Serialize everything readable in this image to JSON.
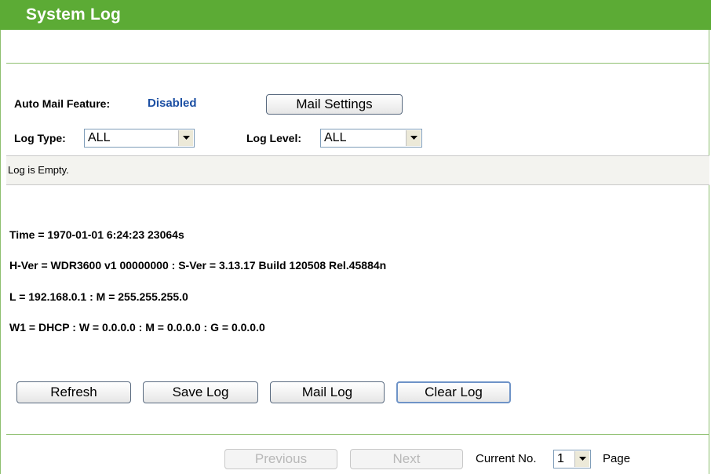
{
  "header": {
    "title": "System Log"
  },
  "mail": {
    "label": "Auto Mail Feature:",
    "status": "Disabled",
    "settings_button": "Mail Settings"
  },
  "filters": {
    "log_type_label": "Log Type:",
    "log_type_value": "ALL",
    "log_level_label": "Log Level:",
    "log_level_value": "ALL"
  },
  "log": {
    "message": "Log is Empty."
  },
  "info": {
    "time": "Time = 1970-01-01 6:24:23 23064s",
    "version": "H-Ver = WDR3600 v1 00000000 : S-Ver = 3.13.17 Build 120508 Rel.45884n",
    "lan": "L = 192.168.0.1 : M = 255.255.255.0",
    "wan": "W1 = DHCP : W = 0.0.0.0 : M = 0.0.0.0 : G = 0.0.0.0"
  },
  "actions": {
    "refresh": "Refresh",
    "save_log": "Save Log",
    "mail_log": "Mail Log",
    "clear_log": "Clear Log"
  },
  "pagination": {
    "previous": "Previous",
    "next": "Next",
    "current_label": "Current No.",
    "current_value": "1",
    "page_label": "Page"
  },
  "colors": {
    "header_bg": "#5cab35",
    "divider": "#8ebf6f",
    "status_disabled": "#1c4fa3"
  }
}
